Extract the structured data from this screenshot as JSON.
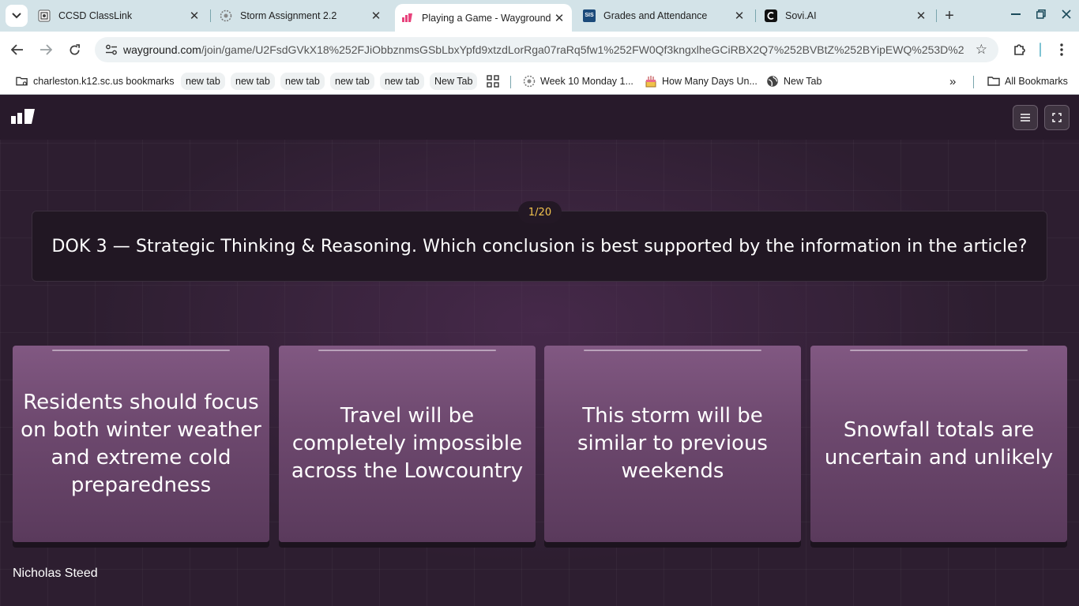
{
  "browser": {
    "tabs": [
      {
        "title": "CCSD ClassLink",
        "icon": "classlink-icon"
      },
      {
        "title": "Storm Assignment 2.2",
        "icon": "gear-icon"
      },
      {
        "title": "Playing a Game - Wayground",
        "icon": "wayground-icon",
        "active": true
      },
      {
        "title": "Grades and Attendance",
        "icon": "sis-icon",
        "icon_text": "SIS"
      },
      {
        "title": "Sovi.AI",
        "icon": "sovi-icon"
      }
    ],
    "url_host": "wayground.com",
    "url_path": "/join/game/U2FsdGVkX18%252FJiObbznmsGSbLbxYpfd9xtzdLorRga07raRq5fw1%252FW0Qf3kngxlheGCiRBX2Q7%252BVBtZ%252BYipEWQ%253D%2...",
    "bookmarks": [
      {
        "label": "charleston.k12.sc.us bookmarks",
        "icon": "folder-gear-icon"
      },
      {
        "label": "new tab"
      },
      {
        "label": "new tab"
      },
      {
        "label": "new tab"
      },
      {
        "label": "new tab"
      },
      {
        "label": "new tab"
      },
      {
        "label": "New Tab"
      },
      {
        "label": "Week 10 Monday 1...",
        "icon": "gear-icon"
      },
      {
        "label": "How Many Days Un...",
        "icon": "cake-icon"
      },
      {
        "label": "New Tab",
        "icon": "globe-icon"
      }
    ],
    "all_bookmarks": "All Bookmarks"
  },
  "game": {
    "counter": "1/20",
    "question": "DOK 3 — Strategic Thinking & Reasoning. Which conclusion is best supported by the information in the article?",
    "options": [
      "Residents should focus on both winter weather and extreme cold preparedness",
      "Travel will be completely impossible across the Lowcountry",
      "This storm will be similar to previous weekends",
      "Snowfall totals are uncertain and unlikely"
    ],
    "player_name": "Nicholas Steed"
  }
}
